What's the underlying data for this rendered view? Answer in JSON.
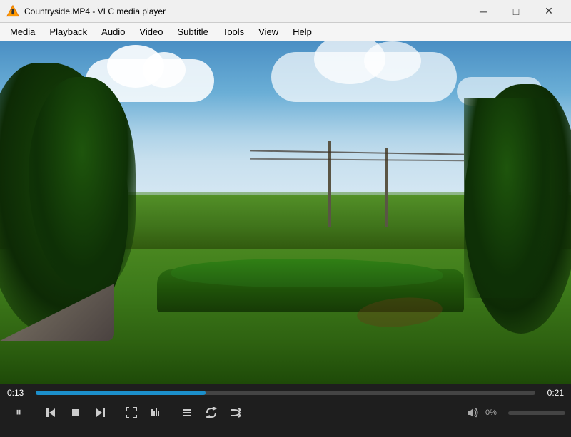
{
  "window": {
    "title": "Countryside.MP4 - VLC media player",
    "controls": {
      "minimize": "─",
      "maximize": "□",
      "close": "✕"
    }
  },
  "menu": {
    "items": [
      "Media",
      "Playback",
      "Audio",
      "Video",
      "Subtitle",
      "Tools",
      "View",
      "Help"
    ]
  },
  "player": {
    "time_current": "0:13",
    "time_total": "0:21",
    "progress_pct": 34,
    "volume_pct": "0%",
    "volume_level": 0
  },
  "controls": {
    "pause_icon": "⏸",
    "prev_icon": "⏮",
    "stop_icon": "■",
    "next_icon": "⏭",
    "fullscreen_icon": "⛶",
    "eq_icon": "∥∥",
    "playlist_icon": "☰",
    "loop_icon": "↺",
    "shuffle_icon": "⇄",
    "volume_icon": "🔊"
  }
}
